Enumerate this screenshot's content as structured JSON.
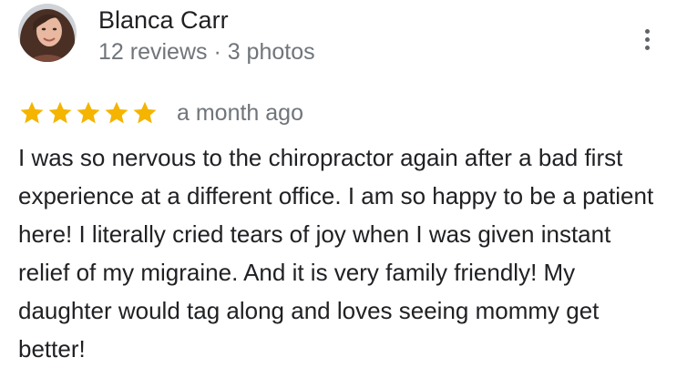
{
  "reviewer": {
    "name": "Blanca Carr",
    "meta": "12 reviews · 3 photos",
    "avatar": "avatar-photo"
  },
  "review": {
    "rating": 5,
    "max_rating": 5,
    "time_ago": "a month ago",
    "text": "I was so nervous to the chiropractor again after a bad first experience at a different office. I am so happy to be a patient here! I literally cried tears of joy when I was given instant relief of my migraine. And it is very family friendly! My daughter would tag along and loves seeing mommy get better!"
  },
  "icons": {
    "more_menu": "more-vertical-icon",
    "star": "star-icon"
  },
  "colors": {
    "star": "#f4b400",
    "name": "#202124",
    "secondary": "#70757a",
    "body": "#202124"
  }
}
